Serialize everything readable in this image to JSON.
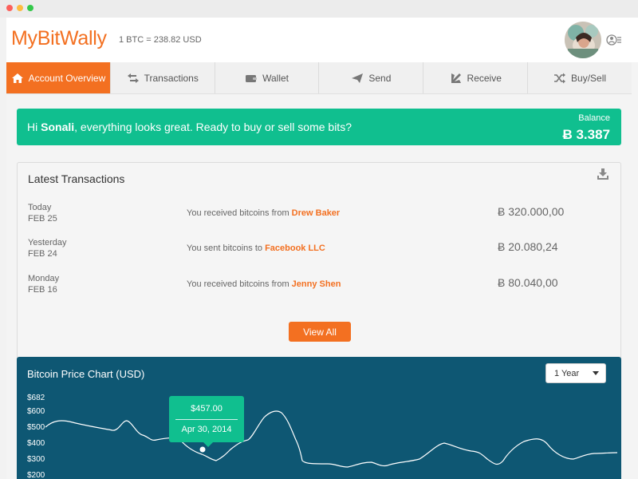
{
  "app": {
    "logo": "MyBitWally",
    "rate": "1 BTC = 238.82 USD"
  },
  "header": {
    "avatar_icon": "user-avatar-photo",
    "menu_icon": "user-menu-icon"
  },
  "tabs": [
    {
      "label": "Account Overview",
      "icon": "home-icon",
      "active": true
    },
    {
      "label": "Transactions",
      "icon": "arrows-exchange-icon"
    },
    {
      "label": "Wallet",
      "icon": "wallet-icon"
    },
    {
      "label": "Send",
      "icon": "send-icon"
    },
    {
      "label": "Receive",
      "icon": "receive-icon"
    },
    {
      "label": "Buy/Sell",
      "icon": "shuffle-icon"
    }
  ],
  "banner": {
    "greeting": "Hi ",
    "name": "Sonali",
    "message": ", everything looks great. Ready to buy or sell some bits?",
    "balance_label": "Balance",
    "balance_value": "Ƀ 3.387"
  },
  "transactions": {
    "title": "Latest Transactions",
    "rows": [
      {
        "day": "Today",
        "date": "FEB 25",
        "desc": "You received bitcoins from ",
        "party": "Drew Baker",
        "amount": "Ƀ 320.000,00"
      },
      {
        "day": "Yesterday",
        "date": "FEB 24",
        "desc": "You sent bitcoins to ",
        "party": "Facebook LLC",
        "amount": "Ƀ 20.080,24"
      },
      {
        "day": "Monday",
        "date": "FEB 16",
        "desc": "You received bitcoins from ",
        "party": "Jenny Shen",
        "amount": "Ƀ 80.040,00"
      }
    ],
    "view_all": "View All"
  },
  "price_chart": {
    "title": "Bitcoin Price Chart (USD)",
    "range": "1 Year",
    "yticks": [
      "$682",
      "$600",
      "$500",
      "$400",
      "$300",
      "$200"
    ],
    "tooltip": {
      "value": "$457.00",
      "date": "Apr 30, 2014"
    }
  },
  "colors": {
    "accent": "#f37021",
    "success": "#10bf8f",
    "chart_bg": "#0e5773"
  }
}
